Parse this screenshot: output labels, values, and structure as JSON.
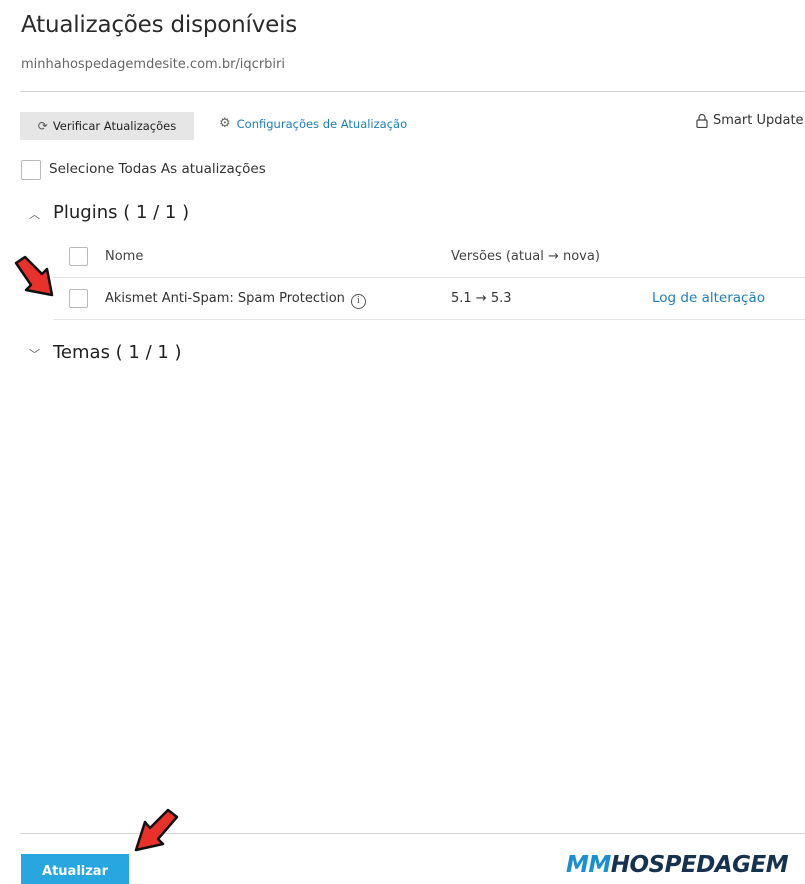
{
  "page": {
    "title": "Atualizações disponíveis",
    "subtitle": "minhahospedagemdesite.com.br/iqcrbiri"
  },
  "toolbar": {
    "check_updates_label": "Verificar Atualizações",
    "settings_label": "Configurações de Atualização",
    "smart_update_label": "Smart Update"
  },
  "select_all_label": "Selecione Todas As atualizações",
  "plugins": {
    "title": "Plugins ( 1 / 1 )",
    "columns": {
      "name": "Nome",
      "versions": "Versões (atual → nova)"
    },
    "rows": [
      {
        "name": "Akismet Anti-Spam: Spam Protection",
        "versions": "5.1 → 5.3",
        "changelog": "Log de alteração"
      }
    ]
  },
  "themes": {
    "title": "Temas ( 1 / 1 )"
  },
  "footer": {
    "update_button_label": "Atualizar",
    "logo_mm": "MM",
    "logo_rest": "HOSPEDAGEM"
  },
  "icons": {
    "refresh": "refresh-icon",
    "gear": "gear-icon",
    "lock": "lock-icon",
    "chevron_up": "chevron-up-icon",
    "chevron_down": "chevron-down-icon",
    "info": "info-icon",
    "annotation_arrow": "red-arrow-icon"
  },
  "colors": {
    "link": "#1f7fb3",
    "primary_button": "#28a6e0",
    "annotation_arrow": "#e8312a"
  }
}
